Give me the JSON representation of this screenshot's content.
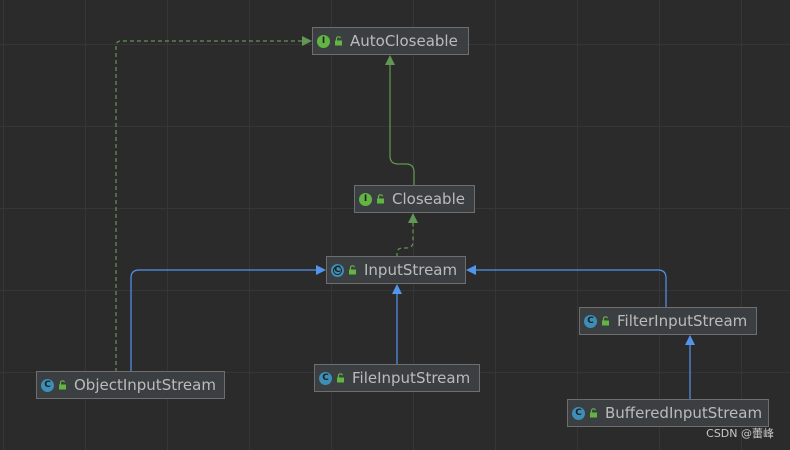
{
  "diagram": {
    "nodes": [
      {
        "id": "autocloseable",
        "label": "AutoCloseable",
        "kind": "interface",
        "badge": "I"
      },
      {
        "id": "closeable",
        "label": "Closeable",
        "kind": "interface",
        "badge": "I"
      },
      {
        "id": "inputstream",
        "label": "InputStream",
        "kind": "abstract-class",
        "badge": "C"
      },
      {
        "id": "filterinputstream",
        "label": "FilterInputStream",
        "kind": "class",
        "badge": "C"
      },
      {
        "id": "objectinputstream",
        "label": "ObjectInputStream",
        "kind": "class",
        "badge": "C"
      },
      {
        "id": "fileinputstream",
        "label": "FileInputStream",
        "kind": "class",
        "badge": "C"
      },
      {
        "id": "bufferedinputstream",
        "label": "BufferedInputStream",
        "kind": "class",
        "badge": "C"
      }
    ],
    "edges": [
      {
        "from": "closeable",
        "to": "autocloseable",
        "type": "extends",
        "style": "solid",
        "color": "#629755"
      },
      {
        "from": "inputstream",
        "to": "closeable",
        "type": "implements",
        "style": "dashed",
        "color": "#629755"
      },
      {
        "from": "objectinputstream",
        "to": "autocloseable",
        "type": "implements",
        "style": "dashed",
        "color": "#629755"
      },
      {
        "from": "objectinputstream",
        "to": "inputstream",
        "type": "extends",
        "style": "solid",
        "color": "#5394ec"
      },
      {
        "from": "fileinputstream",
        "to": "inputstream",
        "type": "extends",
        "style": "solid",
        "color": "#5394ec"
      },
      {
        "from": "filterinputstream",
        "to": "inputstream",
        "type": "extends",
        "style": "solid",
        "color": "#5394ec"
      },
      {
        "from": "bufferedinputstream",
        "to": "filterinputstream",
        "type": "extends",
        "style": "solid",
        "color": "#5394ec"
      }
    ]
  },
  "colors": {
    "background": "#2b2b2b",
    "grid": "#363636",
    "node_fill": "#3c3f41",
    "node_border": "#6e6e6e",
    "text": "#bbbbbb",
    "interface_badge": "#62b543",
    "class_badge": "#3d8fb8",
    "interface_edge": "#629755",
    "class_edge": "#5394ec"
  },
  "icons": {
    "lock": "unlocked-padlock-icon"
  },
  "watermark": "CSDN @蕾峰"
}
